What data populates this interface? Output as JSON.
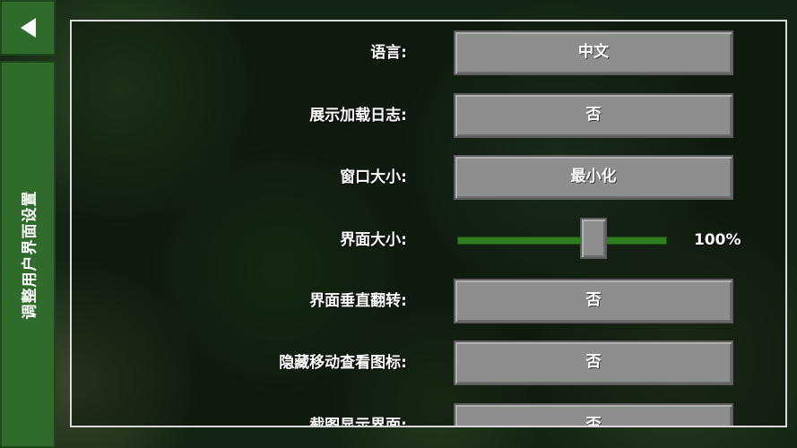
{
  "side_tab": {
    "label": "调整用户界面设置"
  },
  "settings": [
    {
      "label": "语言:",
      "value": "中文"
    },
    {
      "label": "展示加载日志:",
      "value": "否"
    },
    {
      "label": "窗口大小:",
      "value": "最小化"
    },
    {
      "label": "界面大小:",
      "value": "100%",
      "slider_percent": 65
    },
    {
      "label": "界面垂直翻转:",
      "value": "否"
    },
    {
      "label": "隐藏移动查看图标:",
      "value": "否"
    },
    {
      "label": "截图显示界面:",
      "value": "否"
    }
  ]
}
